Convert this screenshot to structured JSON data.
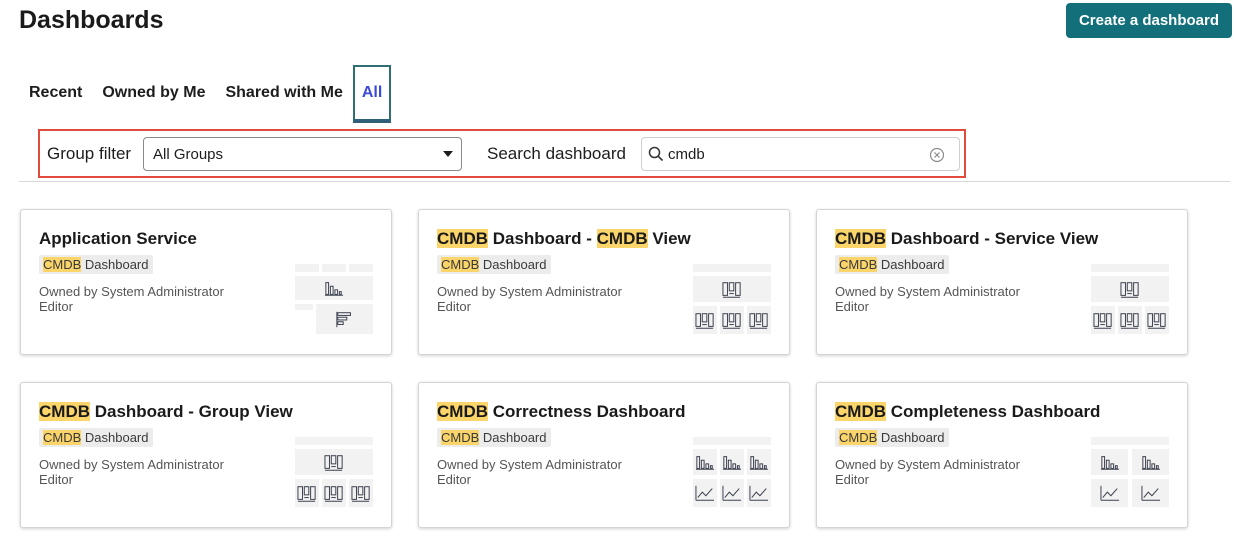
{
  "header": {
    "title": "Dashboards",
    "create_label": "Create a dashboard"
  },
  "tabs": [
    {
      "label": "Recent",
      "active": false
    },
    {
      "label": "Owned by Me",
      "active": false
    },
    {
      "label": "Shared with Me",
      "active": false
    },
    {
      "label": "All",
      "active": true
    }
  ],
  "filters": {
    "group_label": "Group filter",
    "group_value": "All Groups",
    "search_label": "Search dashboard",
    "search_value": "cmdb"
  },
  "colors": {
    "accent": "#13707b",
    "highlight": "#fbd46a",
    "filter_outline": "#e04b3c",
    "active_tab_text": "#3b4bd6"
  },
  "cards": [
    {
      "title_parts": [
        {
          "t": "Application Service",
          "hl": false
        }
      ],
      "tag_parts": [
        {
          "t": "CMDB",
          "hl": true
        },
        {
          "t": " Dashboard",
          "hl": false
        }
      ],
      "owner": "Owned by System Administrator",
      "role": "Editor",
      "thumb": "mixed"
    },
    {
      "title_parts": [
        {
          "t": "CMDB",
          "hl": true
        },
        {
          "t": " Dashboard - ",
          "hl": false
        },
        {
          "t": "CMDB",
          "hl": true
        },
        {
          "t": " View",
          "hl": false
        }
      ],
      "tag_parts": [
        {
          "t": "CMDB",
          "hl": true
        },
        {
          "t": " Dashboard",
          "hl": false
        }
      ],
      "owner": "Owned by System Administrator",
      "role": "Editor",
      "thumb": "tiles"
    },
    {
      "title_parts": [
        {
          "t": "CMDB",
          "hl": true
        },
        {
          "t": " Dashboard - Service View",
          "hl": false
        }
      ],
      "tag_parts": [
        {
          "t": "CMDB",
          "hl": true
        },
        {
          "t": " Dashboard",
          "hl": false
        }
      ],
      "owner": "Owned by System Administrator",
      "role": "Editor",
      "thumb": "tiles"
    },
    {
      "title_parts": [
        {
          "t": "CMDB",
          "hl": true
        },
        {
          "t": " Dashboard - Group View",
          "hl": false
        }
      ],
      "tag_parts": [
        {
          "t": "CMDB",
          "hl": true
        },
        {
          "t": " Dashboard",
          "hl": false
        }
      ],
      "owner": "Owned by System Administrator",
      "role": "Editor",
      "thumb": "tiles"
    },
    {
      "title_parts": [
        {
          "t": "CMDB",
          "hl": true
        },
        {
          "t": " Correctness Dashboard",
          "hl": false
        }
      ],
      "tag_parts": [
        {
          "t": "CMDB",
          "hl": true
        },
        {
          "t": " Dashboard",
          "hl": false
        }
      ],
      "owner": "Owned by System Administrator",
      "role": "Editor",
      "thumb": "bars3lines3"
    },
    {
      "title_parts": [
        {
          "t": "CMDB",
          "hl": true
        },
        {
          "t": " Completeness Dashboard",
          "hl": false
        }
      ],
      "tag_parts": [
        {
          "t": "CMDB",
          "hl": true
        },
        {
          "t": " Dashboard",
          "hl": false
        }
      ],
      "owner": "Owned by System Administrator",
      "role": "Editor",
      "thumb": "bars2lines2"
    }
  ]
}
